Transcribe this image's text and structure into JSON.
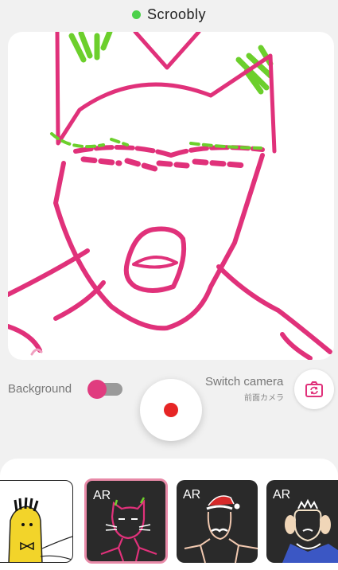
{
  "header": {
    "title": "Scroobly",
    "status": "online"
  },
  "colors": {
    "accent": "#e0317a",
    "status": "#4cd14a",
    "record": "#e62525"
  },
  "controls": {
    "background_label": "Background",
    "background_toggle_on": true,
    "switch_camera_label": "Switch camera",
    "switch_camera_sub": "前面カメラ",
    "switch_camera_icon": "camera-switch-icon",
    "record_icon": "record-icon"
  },
  "filters": [
    {
      "label": "",
      "theme": "yellow-bowtie",
      "selected": false
    },
    {
      "label": "AR",
      "theme": "pink-cat",
      "selected": true
    },
    {
      "label": "AR",
      "theme": "santa-hat",
      "selected": false
    },
    {
      "label": "AR",
      "theme": "tiara",
      "selected": false
    }
  ]
}
